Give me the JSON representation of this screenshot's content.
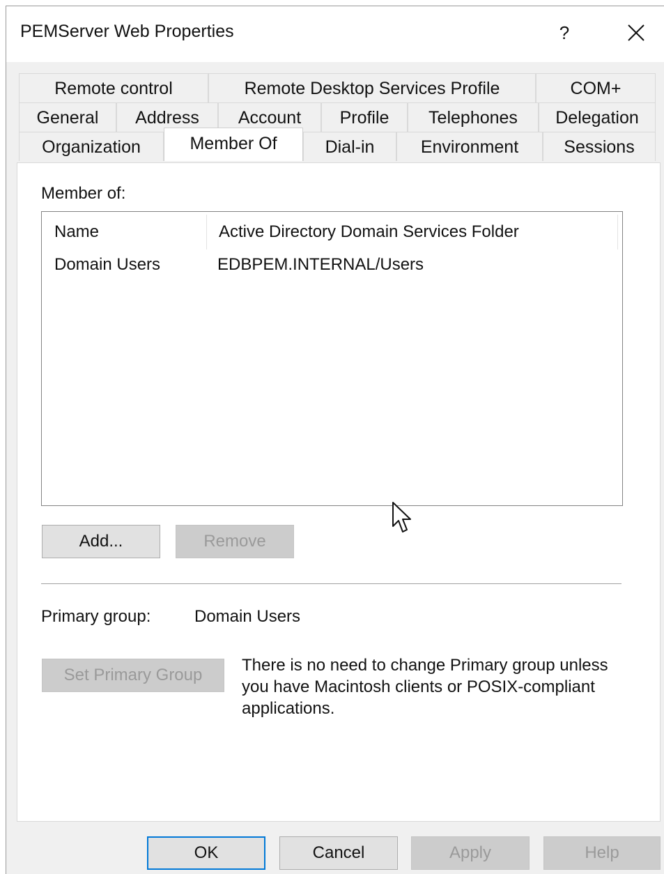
{
  "window": {
    "title": "PEMServer Web Properties",
    "help_label": "?"
  },
  "tabs": {
    "row1": [
      "Remote control",
      "Remote Desktop Services Profile",
      "COM+"
    ],
    "row2": [
      "General",
      "Address",
      "Account",
      "Profile",
      "Telephones",
      "Delegation"
    ],
    "row3": [
      "Organization",
      "Member Of",
      "Dial-in",
      "Environment",
      "Sessions"
    ],
    "active": "Member Of"
  },
  "member_of": {
    "label": "Member of:",
    "columns": [
      "Name",
      "Active Directory Domain Services Folder"
    ],
    "rows": [
      {
        "name": "Domain Users",
        "folder": "EDBPEM.INTERNAL/Users"
      }
    ],
    "add_label": "Add...",
    "remove_label": "Remove"
  },
  "primary_group": {
    "label": "Primary group:",
    "value": "Domain Users",
    "set_button_label": "Set Primary Group",
    "note": "There is no need to change Primary group unless you have Macintosh clients or POSIX-compliant applications."
  },
  "footer": {
    "ok_label": "OK",
    "cancel_label": "Cancel",
    "apply_label": "Apply",
    "help_label": "Help"
  },
  "icons": {
    "close": "close-icon",
    "cursor": "mouse-pointer-icon"
  }
}
